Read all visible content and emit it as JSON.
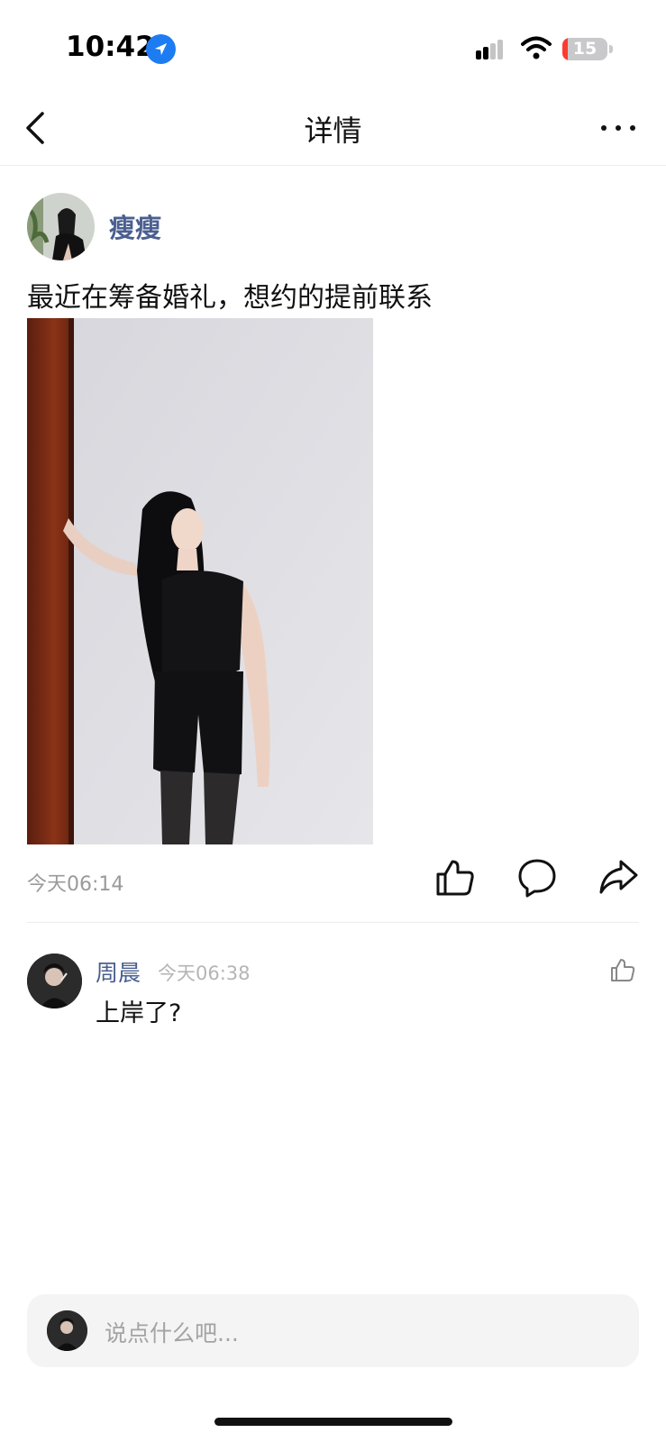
{
  "status_bar": {
    "time": "10:42",
    "battery": "15"
  },
  "nav": {
    "title": "详情"
  },
  "post": {
    "author": "瘦瘦",
    "text": "最近在筹备婚礼，想约的提前联系",
    "time": "今天06:14"
  },
  "comments": [
    {
      "author": "周晨",
      "time": "今天06:38",
      "text": "上岸了?"
    }
  ],
  "input": {
    "placeholder": "说点什么吧..."
  },
  "colors": {
    "accent_name": "#4a5f8f",
    "location_blue": "#1e7cf2",
    "muted_text": "#9a9a9a"
  }
}
